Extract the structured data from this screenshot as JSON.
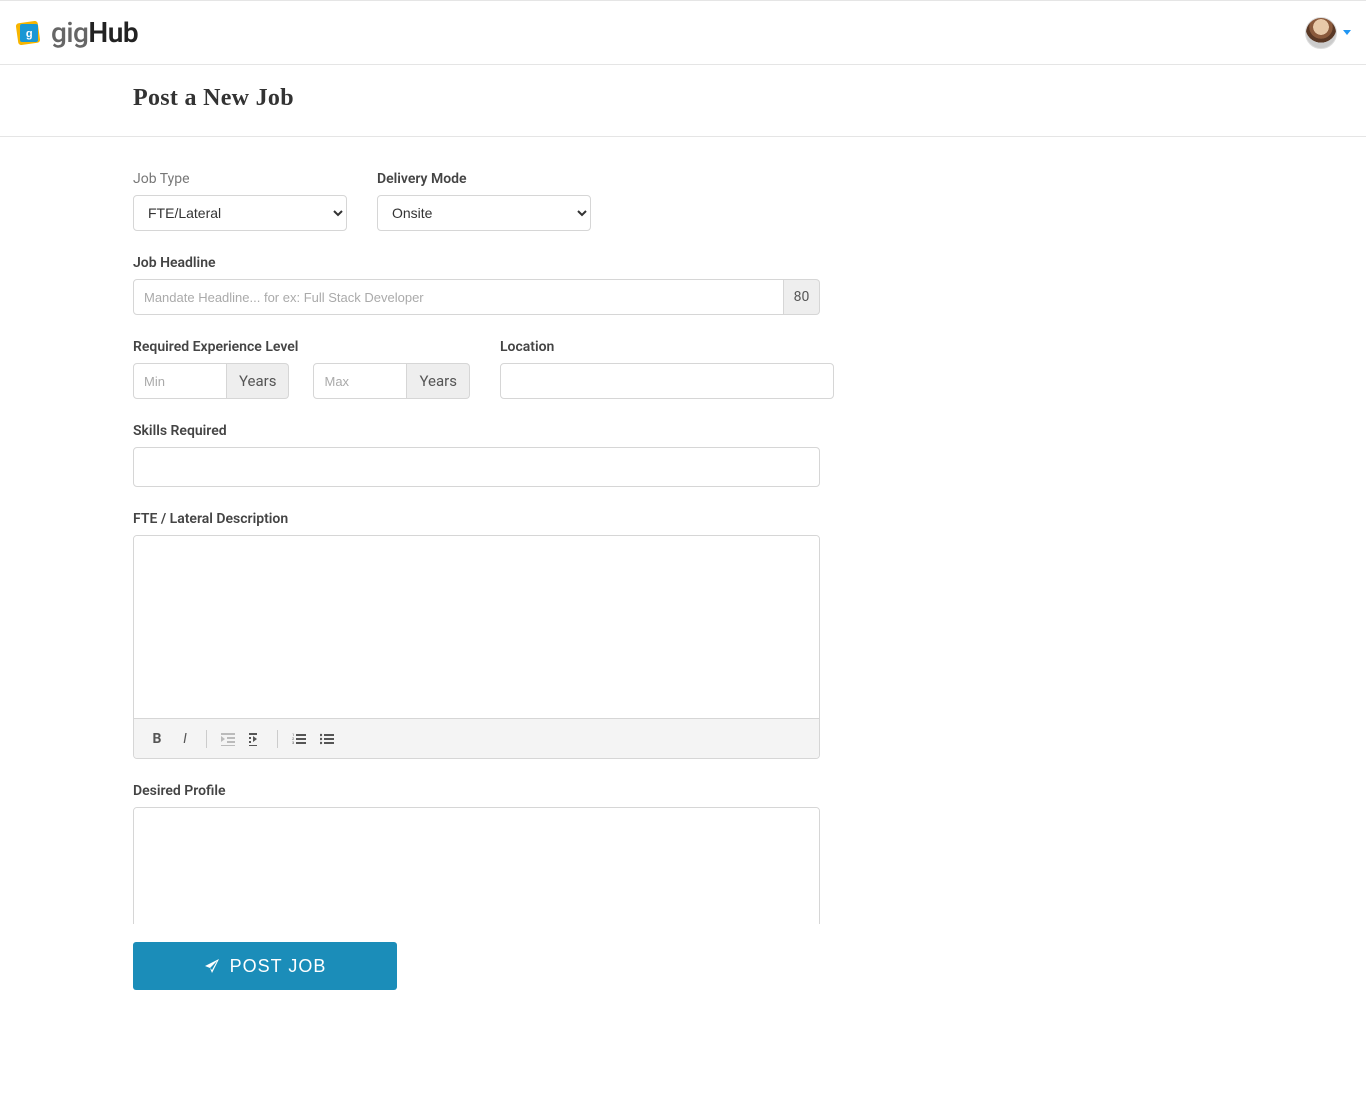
{
  "header": {
    "logo_text_gig": "gig",
    "logo_text_hub": "Hub"
  },
  "page": {
    "title": "Post a New Job"
  },
  "form": {
    "job_type": {
      "label": "Job Type",
      "value": "FTE/Lateral"
    },
    "delivery_mode": {
      "label": "Delivery Mode",
      "value": "Onsite"
    },
    "headline": {
      "label": "Job Headline",
      "placeholder": "Mandate Headline... for ex: Full Stack Developer",
      "count": "80"
    },
    "experience": {
      "label": "Required Experience Level",
      "min_placeholder": "Min",
      "max_placeholder": "Max",
      "suffix": "Years"
    },
    "location": {
      "label": "Location"
    },
    "skills": {
      "label": "Skills Required"
    },
    "description": {
      "label": "FTE / Lateral Description"
    },
    "profile": {
      "label": "Desired Profile"
    }
  },
  "footer": {
    "post_label": "POST JOB"
  }
}
